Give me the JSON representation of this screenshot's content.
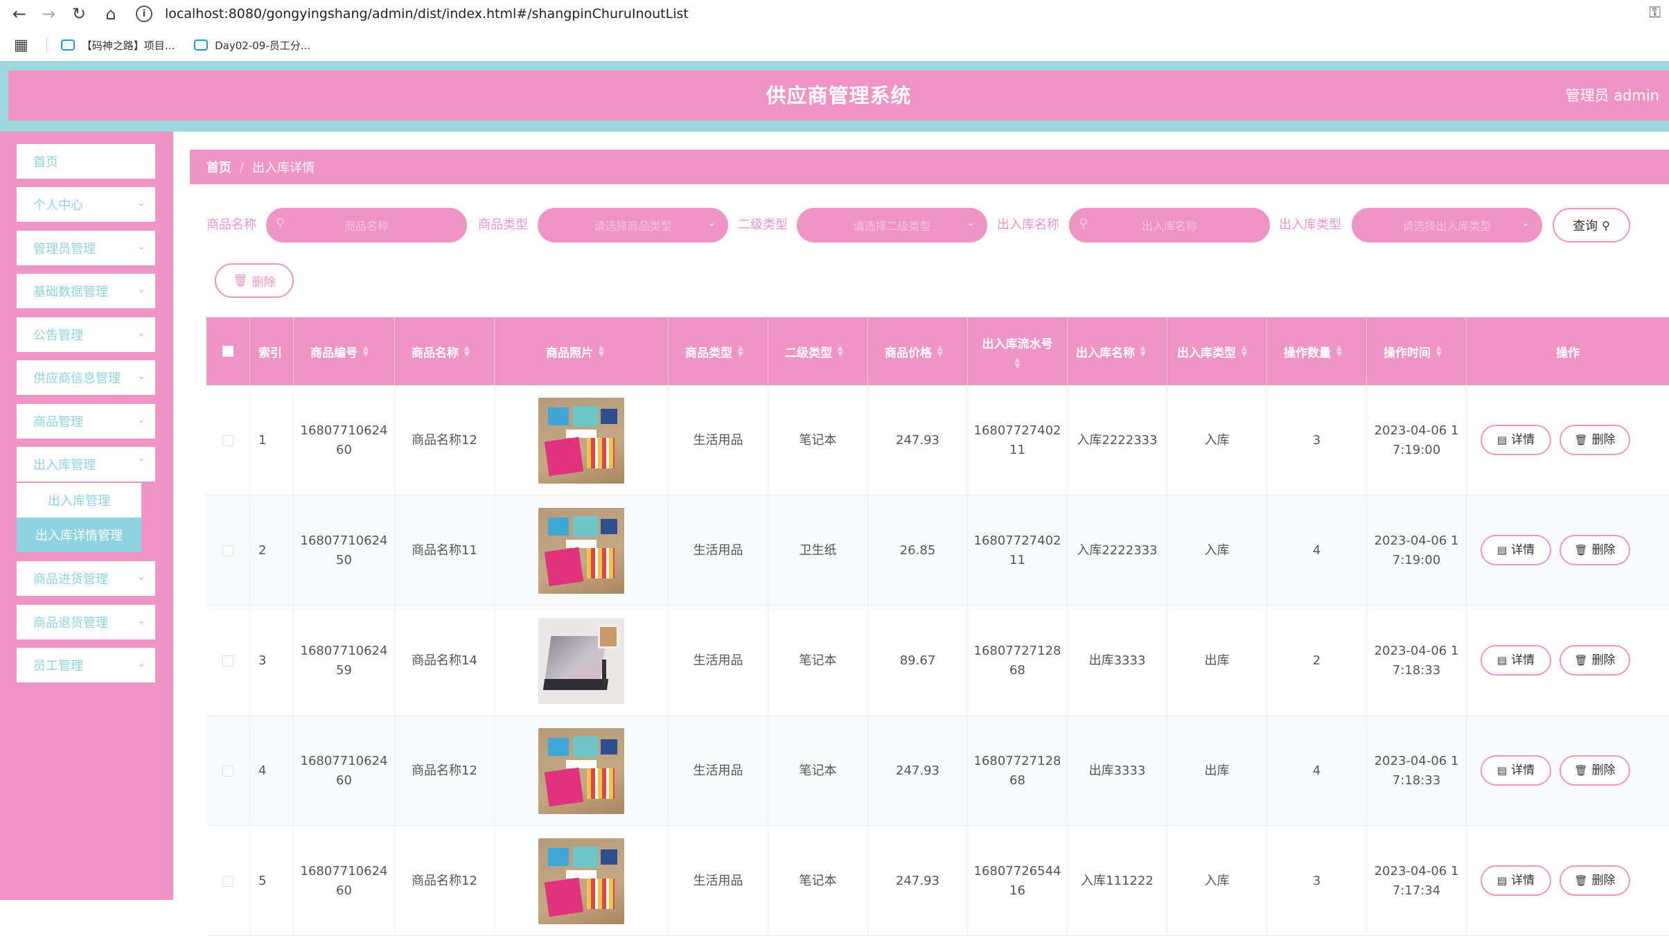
{
  "browser": {
    "url": "localhost:8080/gongyingshang/admin/dist/index.html#/shangpinChuruInoutList",
    "bookmarks": [
      "【码神之路】项目...",
      "Day02-09-员工分..."
    ]
  },
  "header": {
    "title": "供应商管理系统",
    "admin": "管理员 admin"
  },
  "sidebar": {
    "items": [
      {
        "label": "首页"
      },
      {
        "label": "个人中心"
      },
      {
        "label": "管理员管理"
      },
      {
        "label": "基础数据管理"
      },
      {
        "label": "公告管理"
      },
      {
        "label": "供应商信息管理"
      },
      {
        "label": "商品管理"
      },
      {
        "label": "出入库管理"
      },
      {
        "label": "商品进货管理"
      },
      {
        "label": "商品退货管理"
      },
      {
        "label": "员工管理"
      }
    ],
    "submenu": [
      {
        "label": "出入库管理"
      },
      {
        "label": "出入库详情管理"
      }
    ]
  },
  "breadcrumb": {
    "home": "首页",
    "separator": "/",
    "current": "出入库详情"
  },
  "filters": {
    "name_label": "商品名称",
    "name_placeholder": "商品名称",
    "type_label": "商品类型",
    "type_placeholder": "请选择商品类型",
    "subtype_label": "二级类型",
    "subtype_placeholder": "请选择二级类型",
    "inout_name_label": "出入库名称",
    "inout_name_placeholder": "出入库名称",
    "inout_type_label": "出入库类型",
    "inout_type_placeholder": "请选择出入库类型",
    "query_label": "查询"
  },
  "toolbar": {
    "delete_label": "删除"
  },
  "table": {
    "columns": [
      "索引",
      "商品编号",
      "商品名称",
      "商品照片",
      "商品类型",
      "二级类型",
      "商品价格",
      "出入库流水号",
      "出入库名称",
      "出入库类型",
      "操作数量",
      "操作时间",
      "操作"
    ],
    "detail_label": "详情",
    "delete_label": "删除",
    "rows": [
      {
        "index": "1",
        "code_a": "16807710624",
        "code_b": "60",
        "name": "商品名称12",
        "photo": "kit",
        "type": "生活用品",
        "subtype": "笔记本",
        "price": "247.93",
        "serial_a": "16807727402",
        "serial_b": "11",
        "inout_name": "入库2222333",
        "inout_type": "入库",
        "qty": "3",
        "time_a": "2023-04-06 1",
        "time_b": "7:19:00"
      },
      {
        "index": "2",
        "code_a": "16807710624",
        "code_b": "50",
        "name": "商品名称11",
        "photo": "kit",
        "type": "生活用品",
        "subtype": "卫生纸",
        "price": "26.85",
        "serial_a": "16807727402",
        "serial_b": "11",
        "inout_name": "入库2222333",
        "inout_type": "入库",
        "qty": "4",
        "time_a": "2023-04-06 1",
        "time_b": "7:19:00"
      },
      {
        "index": "3",
        "code_a": "16807710624",
        "code_b": "59",
        "name": "商品名称14",
        "photo": "laptop",
        "type": "生活用品",
        "subtype": "笔记本",
        "price": "89.67",
        "serial_a": "16807727128",
        "serial_b": "68",
        "inout_name": "出库3333",
        "inout_type": "出库",
        "qty": "2",
        "time_a": "2023-04-06 1",
        "time_b": "7:18:33"
      },
      {
        "index": "4",
        "code_a": "16807710624",
        "code_b": "60",
        "name": "商品名称12",
        "photo": "kit",
        "type": "生活用品",
        "subtype": "笔记本",
        "price": "247.93",
        "serial_a": "16807727128",
        "serial_b": "68",
        "inout_name": "出库3333",
        "inout_type": "出库",
        "qty": "4",
        "time_a": "2023-04-06 1",
        "time_b": "7:18:33"
      },
      {
        "index": "5",
        "code_a": "16807710624",
        "code_b": "60",
        "name": "商品名称12",
        "photo": "kit",
        "type": "生活用品",
        "subtype": "笔记本",
        "price": "247.93",
        "serial_a": "16807726544",
        "serial_b": "16",
        "inout_name": "入库111222",
        "inout_type": "入库",
        "qty": "3",
        "time_a": "2023-04-06 1",
        "time_b": "7:17:34"
      }
    ]
  },
  "colors": {
    "primary_pink": "#ef95c6",
    "accent_cyan": "#8fd3e0",
    "header_border": "#9ed7dd"
  }
}
